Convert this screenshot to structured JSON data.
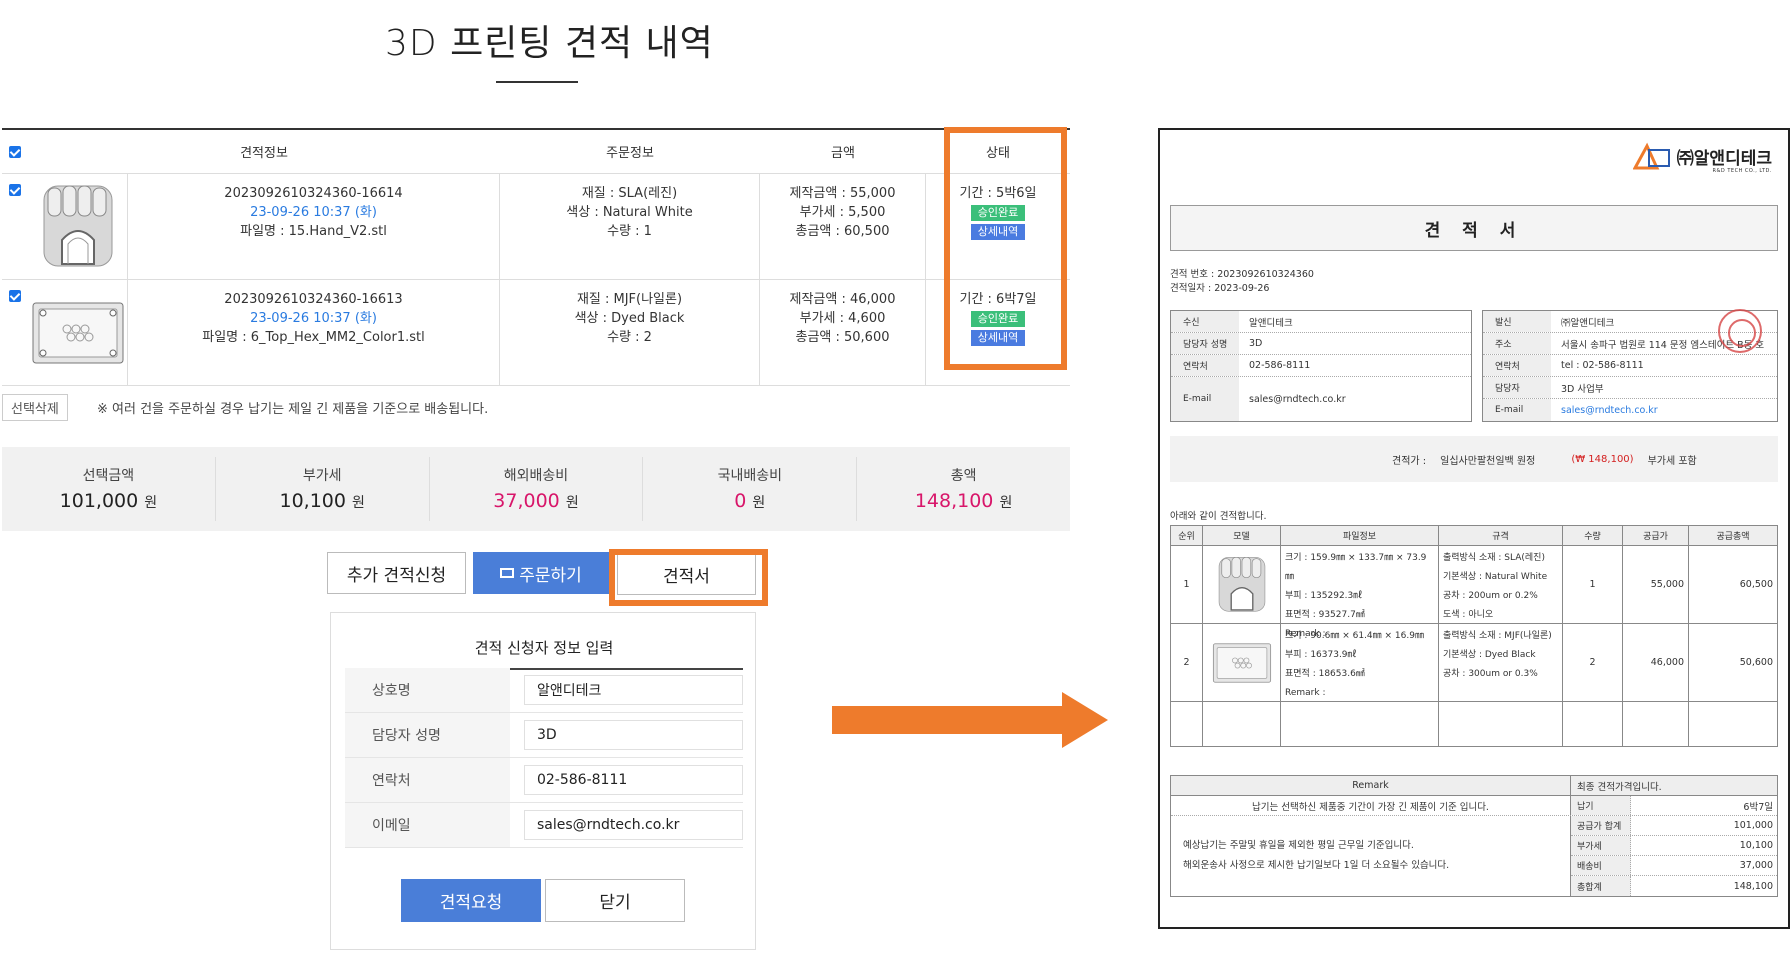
{
  "page": {
    "title": "3D 프린팅 견적 내역"
  },
  "table": {
    "headers": [
      "견적정보",
      "주문정보",
      "금액",
      "상태"
    ],
    "items": [
      {
        "quote_no": "2023092610324360-16614",
        "date": "23-09-26 10:37 (화)",
        "file": "파일명 : 15.Hand_V2.stl",
        "material": "재질 : SLA(레진)",
        "color": "색상 : Natural White",
        "qty": "수량 : 1",
        "make_price": "제작금액 : 55,000",
        "vat": "부가세 : 5,500",
        "total": "총금액 : 60,500",
        "period": "기간 : 5박6일",
        "status": "승인완료",
        "detail": "상세내역"
      },
      {
        "quote_no": "2023092610324360-16613",
        "date": "23-09-26 10:37 (화)",
        "file": "파일명 : 6_Top_Hex_MM2_Color1.stl",
        "material": "재질 : MJF(나일론)",
        "color": "색상 : Dyed Black",
        "qty": "수량 : 2",
        "make_price": "제작금액 : 46,000",
        "vat": "부가세 : 4,600",
        "total": "총금액 : 50,600",
        "period": "기간 : 6박7일",
        "status": "승인완료",
        "detail": "상세내역"
      }
    ]
  },
  "actions": {
    "delete_selected": "선택삭제",
    "note": "※ 여러 건을 주문하실 경우 납기는 제일 긴 제품을 기준으로 배송됩니다."
  },
  "summary": [
    {
      "label": "선택금액",
      "value": "101,000",
      "unit": "원"
    },
    {
      "label": "부가세",
      "value": "10,100",
      "unit": "원"
    },
    {
      "label": "해외배송비",
      "value": "37,000",
      "unit": "원"
    },
    {
      "label": "국내배송비",
      "value": "0",
      "unit": "원"
    },
    {
      "label": "총액",
      "value": "148,100",
      "unit": "원"
    }
  ],
  "buttons": {
    "add_quote": "추가 견적신청",
    "order": "주문하기",
    "quote_doc": "견적서",
    "request": "견적요청",
    "close": "닫기"
  },
  "form": {
    "title": "견적 신청자 정보 입력",
    "fields": [
      {
        "label": "상호명",
        "value": "알앤디테크"
      },
      {
        "label": "담당자 성명",
        "value": "3D"
      },
      {
        "label": "연락처",
        "value": "02-586-8111"
      },
      {
        "label": "이메일",
        "value": "sales@rndtech.co.kr"
      }
    ]
  },
  "doc": {
    "logo": "㈜알앤디테크",
    "logo_sub": "R&D TECH CO., LTD.",
    "title": "견 적 서",
    "quote_no": "견적 번호 : 2023092610324360",
    "quote_date": "견적일자 : 2023-09-26",
    "recipient": [
      {
        "k": "수신",
        "v": "알앤디테크"
      },
      {
        "k": "담당자 성명",
        "v": "3D"
      },
      {
        "k": "연락처",
        "v": "02-586-8111"
      },
      {
        "k": "E-mail",
        "v": "sales@rndtech.co.kr"
      }
    ],
    "sender": [
      {
        "k": "발신",
        "v": "㈜알앤디테크"
      },
      {
        "k": "주소",
        "v": "서울시 송파구 법원로 114 문정 엠스테이트 B동 호"
      },
      {
        "k": "연락처",
        "v": "tel : 02-586-8111"
      },
      {
        "k": "담당자",
        "v": "3D 사업부"
      },
      {
        "k": "E-mail",
        "v": "sales@rndtech.co.kr"
      }
    ],
    "price_label": "견적가 :",
    "price_words": "일십사만팔천일백 원정",
    "price_num": "(₩ 148,100)",
    "price_vat": "부가세 포함",
    "intro": "아래와 같이 견적합니다.",
    "grid_headers": [
      "순위",
      "모델",
      "파일정보",
      "규격",
      "수량",
      "공급가",
      "공급총액"
    ],
    "grid_rows": [
      {
        "no": "1",
        "file": [
          "크기 : 159.9㎜ × 133.7㎜ × 73.9㎜",
          "부피 : 135292.3㎖",
          "표면적 : 93527.7㎟",
          "Remark :"
        ],
        "spec": [
          "출력방식 소재 : SLA(레진)",
          "기본색상 : Natural White",
          "공차 : 200um or 0.2%",
          "도색 : 아니오"
        ],
        "qty": "1",
        "price": "55,000",
        "total": "60,500"
      },
      {
        "no": "2",
        "file": [
          "크기 : 90.6㎜ × 61.4㎜ × 16.9㎜",
          "부피 : 16373.9㎖",
          "표면적 : 18653.6㎟",
          "Remark :"
        ],
        "spec": [
          "출력방식 소재 : MJF(나일론)",
          "기본색상 : Dyed Black",
          "공차 : 300um or 0.3%"
        ],
        "qty": "2",
        "price": "46,000",
        "total": "50,600"
      }
    ],
    "remark_label": "Remark",
    "remark_note": "납기는 선택하신 제품중 기간이 가장 긴 제품이 기준 입니다.",
    "final_label": "최종 견적가격입니다.",
    "notes": [
      "예상납기는 주말및 휴일을 제외한 평일 근무일 기준입니다.",
      "해외운송사 사정으로 제시한 납기일보다 1일 더 소요될수 있습니다."
    ],
    "totals": [
      {
        "k": "납기",
        "v": "6박7일"
      },
      {
        "k": "공급가 합계",
        "v": "101,000"
      },
      {
        "k": "부가세",
        "v": "10,100"
      },
      {
        "k": "배송비",
        "v": "37,000"
      },
      {
        "k": "총합계",
        "v": "148,100"
      }
    ]
  },
  "colors": {
    "accent_orange": "#ee7b2c",
    "primary_blue": "#4a7ed8",
    "pink": "#d8166a",
    "approved_green": "#3bbf7a"
  }
}
